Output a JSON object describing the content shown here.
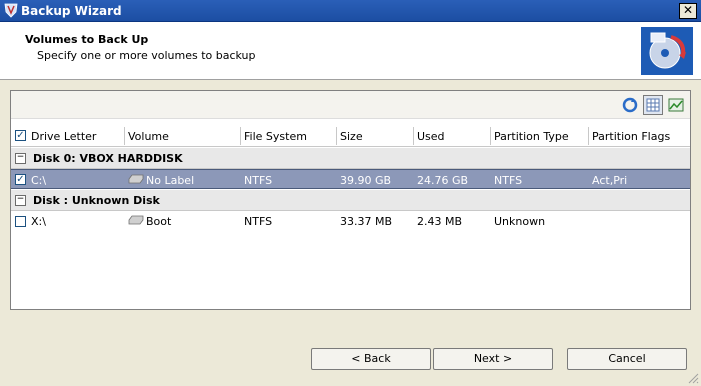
{
  "window": {
    "title": "Backup Wizard",
    "close_glyph": "✕"
  },
  "header": {
    "title": "Volumes to Back Up",
    "subtitle": "Specify one or more volumes to backup",
    "logo_icon": "backup-disc-icon"
  },
  "toolbar": {
    "icons": [
      "refresh-icon",
      "grid-view-icon",
      "chart-view-icon"
    ]
  },
  "columns": [
    "Drive Letter",
    "Volume",
    "File System",
    "Size",
    "Used",
    "Partition Type",
    "Partition Flags"
  ],
  "groups": [
    {
      "label": "Disk 0: VBOX HARDDISK",
      "rows": [
        {
          "checked": true,
          "selected": true,
          "drive": "C:\\",
          "volume": "No Label",
          "fs": "NTFS",
          "size": "39.90 GB",
          "used": "24.76 GB",
          "ptype": "NTFS",
          "pflags": "Act,Pri"
        }
      ]
    },
    {
      "label": "Disk : Unknown Disk",
      "rows": [
        {
          "checked": false,
          "selected": false,
          "drive": "X:\\",
          "volume": "Boot",
          "fs": "NTFS",
          "size": "33.37 MB",
          "used": "2.43 MB",
          "ptype": "Unknown",
          "pflags": ""
        }
      ]
    }
  ],
  "buttons": {
    "back": "< Back",
    "next": "Next >",
    "cancel": "Cancel"
  },
  "colors": {
    "titlebar": "#1c4ea3",
    "selection": "#8c98b8",
    "group_bg": "#e8e8e8"
  }
}
